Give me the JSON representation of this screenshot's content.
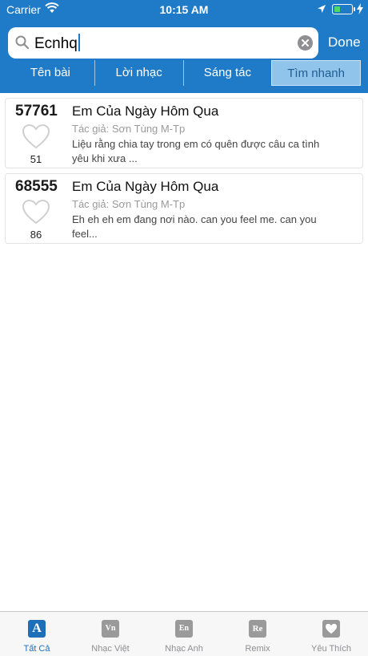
{
  "status": {
    "carrier": "Carrier",
    "time": "10:15 AM",
    "battery_level": 0.35
  },
  "search": {
    "query": "Ecnhq",
    "done_label": "Done"
  },
  "segments": [
    {
      "label": "Tên bài"
    },
    {
      "label": "Lời nhạc"
    },
    {
      "label": "Sáng tác"
    },
    {
      "label": "Tìm nhanh"
    }
  ],
  "active_segment": "Tìm nhanh",
  "results": [
    {
      "id": "57761",
      "likes": "51",
      "title": "Em Của Ngày Hôm Qua",
      "author": "Tác giả: Sơn Tùng M-Tp",
      "lyric": "Liệu rằng chia tay trong em có quên được câu ca tình yêu khi xưa ..."
    },
    {
      "id": "68555",
      "likes": "86",
      "title": "Em Của Ngày Hôm Qua",
      "author": "Tác giả: Sơn Tùng M-Tp",
      "lyric": "Eh eh eh em đang nơi nào. can you feel me. can you feel..."
    }
  ],
  "tabbar": [
    {
      "label": "Tất Cả",
      "icon": "letter-a-icon",
      "glyph": "A"
    },
    {
      "label": "Nhạc Việt",
      "icon": "vn-music-icon",
      "glyph": "Vn"
    },
    {
      "label": "Nhạc Anh",
      "icon": "en-music-icon",
      "glyph": "En"
    },
    {
      "label": "Remix",
      "icon": "remix-icon",
      "glyph": "Re"
    },
    {
      "label": "Yêu Thích",
      "icon": "favorite-heart-icon",
      "glyph": ""
    }
  ],
  "colors": {
    "accent": "#1f7bc7",
    "active_tab": "#1f6fb8",
    "segment_active": "#90c4ea"
  }
}
